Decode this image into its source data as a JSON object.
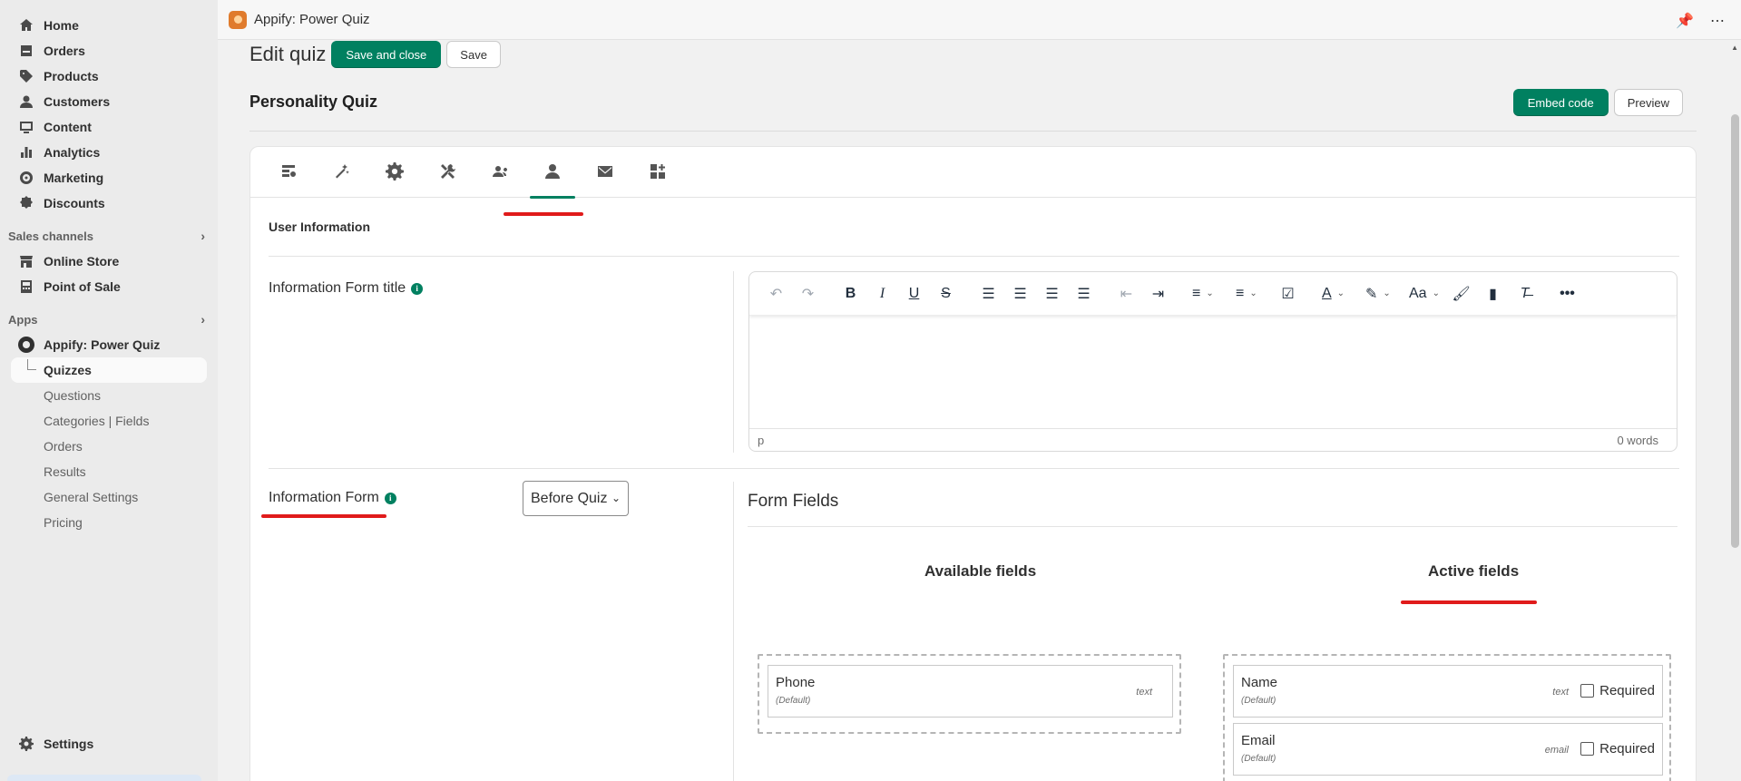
{
  "sidebar": {
    "nav": [
      {
        "label": "Home",
        "icon": "home-icon"
      },
      {
        "label": "Orders",
        "icon": "orders-icon"
      },
      {
        "label": "Products",
        "icon": "tag-icon"
      },
      {
        "label": "Customers",
        "icon": "person-icon"
      },
      {
        "label": "Content",
        "icon": "content-icon"
      },
      {
        "label": "Analytics",
        "icon": "chart-icon"
      },
      {
        "label": "Marketing",
        "icon": "target-icon"
      },
      {
        "label": "Discounts",
        "icon": "discount-icon"
      }
    ],
    "sales_channels_label": "Sales channels",
    "channels": [
      {
        "label": "Online Store",
        "icon": "store-icon"
      },
      {
        "label": "Point of Sale",
        "icon": "pos-icon"
      }
    ],
    "apps_label": "Apps",
    "app_name": "Appify: Power Quiz",
    "app_sub": [
      "Quizzes",
      "Questions",
      "Categories | Fields",
      "Orders",
      "Results",
      "General Settings",
      "Pricing"
    ],
    "settings_label": "Settings"
  },
  "topbar": {
    "title": "Appify: Power Quiz",
    "pin_icon": "pin-icon",
    "more_icon": "more-icon"
  },
  "header": {
    "edit_title": "Edit quiz",
    "save_close_label": "Save and close",
    "save_label": "Save",
    "quiz_name": "Personality Quiz",
    "embed_label": "Embed code",
    "preview_label": "Preview"
  },
  "tabs": [
    "layout-settings-icon",
    "magic-wand-icon",
    "gear-icon",
    "tools-icon",
    "users-icon",
    "user-icon",
    "mail-icon",
    "add-blocks-icon"
  ],
  "active_tab": 5,
  "section": {
    "title": "User Information",
    "form_title_label": "Information Form title",
    "form_label": "Information Form",
    "form_position": "Before Quiz"
  },
  "editor": {
    "status_tag": "p",
    "word_count": "0 words"
  },
  "form_fields": {
    "title": "Form Fields",
    "available_title": "Available fields",
    "active_title": "Active fields",
    "available": [
      {
        "name": "Phone",
        "default": "(Default)",
        "type": "text"
      }
    ],
    "active": [
      {
        "name": "Name",
        "default": "(Default)",
        "type": "text",
        "required_label": "Required"
      },
      {
        "name": "Email",
        "default": "(Default)",
        "type": "email",
        "required_label": "Required"
      }
    ]
  },
  "colors": {
    "primary": "#008060",
    "annotation": "#e01b1b"
  }
}
